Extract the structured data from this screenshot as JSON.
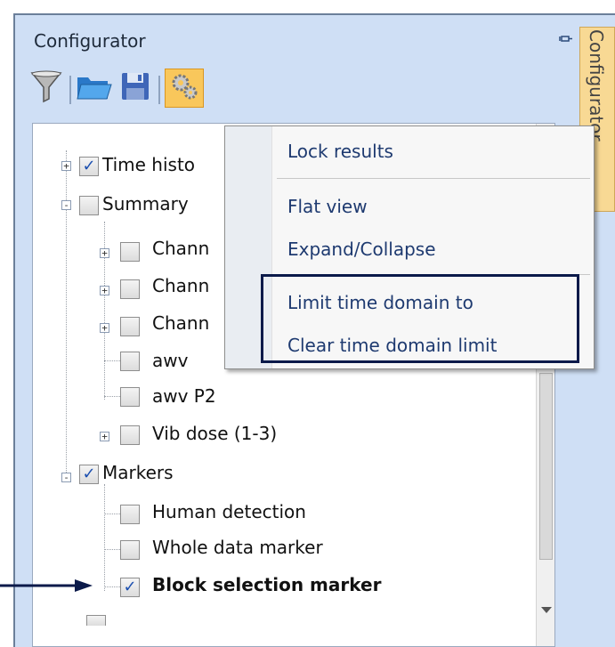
{
  "panel": {
    "title": "Configurator",
    "side_tab_label": "Configurator"
  },
  "toolbar": {
    "buttons": [
      "filter-icon",
      "open-folder-icon",
      "save-icon",
      "settings-gears-icon"
    ]
  },
  "tree": {
    "items": [
      {
        "label": "Time histo",
        "checked": true,
        "expander": "+",
        "level": 0
      },
      {
        "label": "Summary",
        "checked": false,
        "expander": "-",
        "level": 0
      },
      {
        "label": "Chann",
        "checked": false,
        "expander": "+",
        "level": 1
      },
      {
        "label": "Chann",
        "checked": false,
        "expander": "+",
        "level": 1
      },
      {
        "label": "Chann",
        "checked": false,
        "expander": "+",
        "level": 1
      },
      {
        "label": "awv",
        "checked": false,
        "expander": "",
        "level": 1
      },
      {
        "label": "awv P2",
        "checked": false,
        "expander": "",
        "level": 1
      },
      {
        "label": "Vib dose (1-3)",
        "checked": false,
        "expander": "+",
        "level": 1
      },
      {
        "label": "Markers",
        "checked": true,
        "expander": "-",
        "level": 0
      },
      {
        "label": "Human detection",
        "checked": false,
        "expander": "",
        "level": 1
      },
      {
        "label": "Whole data marker",
        "checked": false,
        "expander": "",
        "level": 1
      },
      {
        "label": "Block selection marker",
        "checked": true,
        "expander": "",
        "level": 1,
        "bold": true
      }
    ]
  },
  "menu": {
    "items": [
      "Lock results",
      "Flat view",
      "Expand/Collapse",
      "Limit time domain to",
      "Clear time domain limit"
    ]
  },
  "check_mark": "✓"
}
